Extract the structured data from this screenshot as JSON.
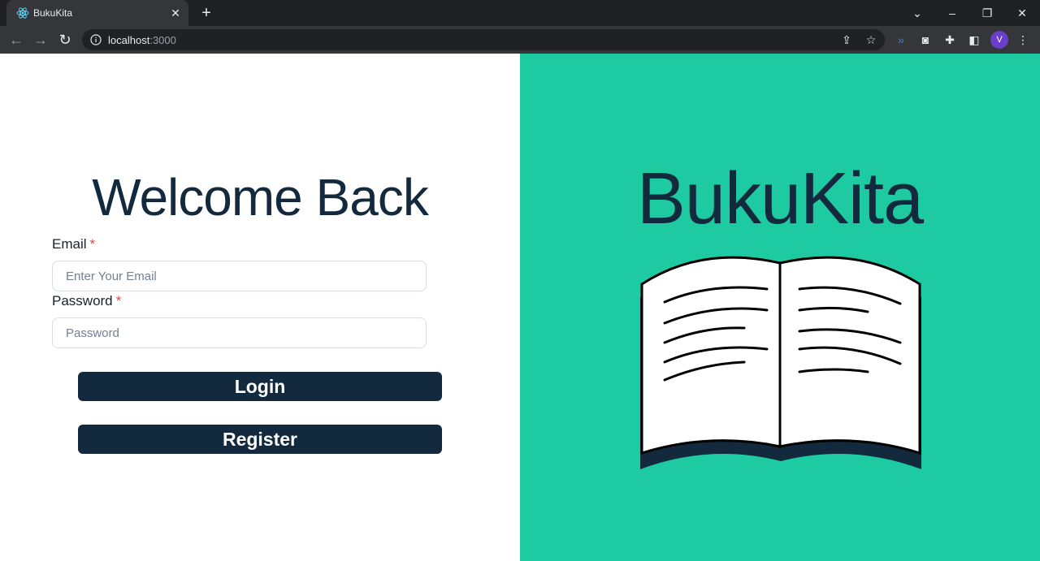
{
  "browser": {
    "tab_title": "BukuKita",
    "tab_close": "✕",
    "new_tab": "+",
    "url_host": "localhost",
    "url_port": ":3000",
    "profile_initial": "V"
  },
  "login": {
    "heading": "Welcome Back",
    "email_label": "Email",
    "email_placeholder": "Enter Your Email",
    "password_label": "Password",
    "password_placeholder": "Password",
    "required_mark": "*",
    "login_button": "Login",
    "register_button": "Register"
  },
  "brand": {
    "name": "BukuKita",
    "accent_color": "#1ecaa1",
    "dark_color": "#13293d"
  },
  "icons": {
    "favicon": "react-logo-icon",
    "book": "open-book-icon"
  }
}
